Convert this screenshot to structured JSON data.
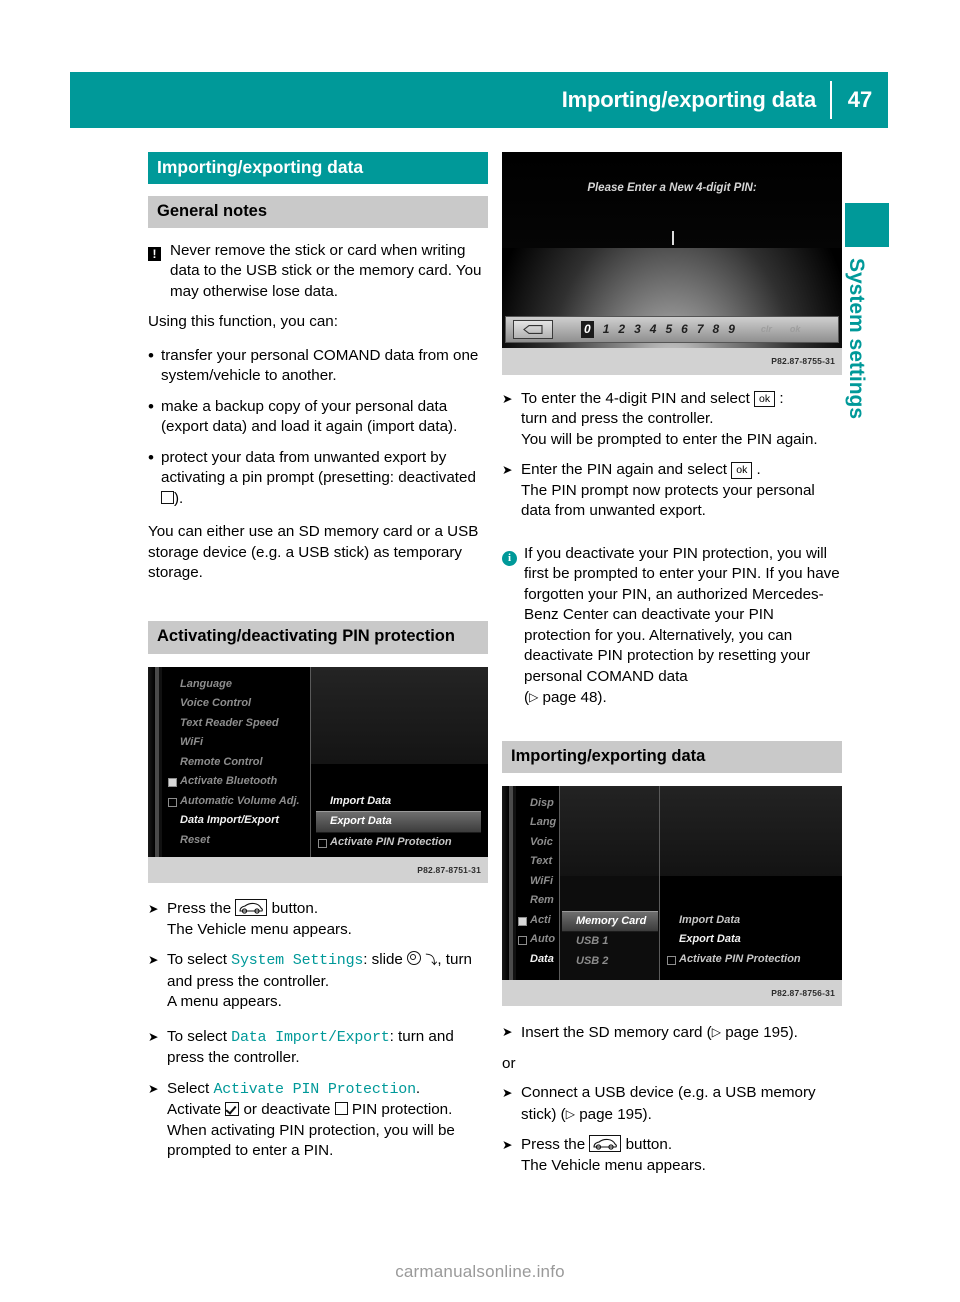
{
  "header": {
    "title": "Importing/exporting data",
    "page_number": "47"
  },
  "side_tab": {
    "label": "System settings",
    "marker": "Z",
    "color": "#009999"
  },
  "left_column": {
    "section_title": "Importing/exporting data",
    "subsection_title": "General notes",
    "warning": "Never remove the stick or card when writing data to the USB stick or the memory card. You may otherwise lose data.",
    "intro": "Using this function, you can:",
    "bullets": [
      "transfer your personal COMAND data from one system/vehicle to another.",
      "make a backup copy of your personal data (export data) and load it again (import data).",
      "protect your data from unwanted export by activating a pin prompt (presetting: deactivated ☐)."
    ],
    "bullet3_pre": "protect your data from unwanted export by activating a pin prompt (presetting: deactivated ",
    "bullet3_post": ").",
    "storage_note": "You can either use an SD memory card or a USB storage device (e.g. a USB stick) as temporary storage.",
    "pin_heading": "Activating/deactivating PIN protection",
    "screenshot": {
      "caption": "P82.87-8751-31",
      "left_menu": [
        {
          "label": "Language",
          "state": "dim",
          "checkbox": "none"
        },
        {
          "label": "Voice Control",
          "state": "dim",
          "checkbox": "none"
        },
        {
          "label": "Text Reader Speed",
          "state": "dim",
          "checkbox": "none"
        },
        {
          "label": "WiFi",
          "state": "dim",
          "checkbox": "none"
        },
        {
          "label": "Remote Control",
          "state": "dim",
          "checkbox": "none"
        },
        {
          "label": "Activate Bluetooth",
          "state": "dim",
          "checkbox": "on"
        },
        {
          "label": "Automatic Volume Adj.",
          "state": "dim",
          "checkbox": "off"
        },
        {
          "label": "Data Import/Export",
          "state": "bright",
          "checkbox": "none"
        },
        {
          "label": "Reset",
          "state": "dim",
          "checkbox": "none"
        }
      ],
      "right_menu": [
        {
          "label": "Import Data",
          "state": "bright",
          "checkbox": "none"
        },
        {
          "label": "Export Data",
          "state": "selected",
          "checkbox": "none"
        },
        {
          "label": "Activate PIN Protection",
          "state": "mid",
          "checkbox": "off"
        }
      ]
    },
    "steps": [
      {
        "marker": "X",
        "text_before_key": "Press the ",
        "key": "vehicle-button",
        "text_after_key": " button.",
        "sub": "The Vehicle menu appears."
      },
      {
        "marker": "X",
        "text_before_cmd": "To select ",
        "command": "System Settings",
        "text_after_cmd": ": slide ",
        "text_tail": ", turn and press the controller.",
        "sub": "A menu appears."
      },
      {
        "marker": "X",
        "text_before_cmd": "To select ",
        "command": "Data Import/Export",
        "text_after_cmd": ": turn and press the controller.",
        "sub": ""
      },
      {
        "marker": "X",
        "text_before_cmd": "Select ",
        "command": "Activate PIN Protection",
        "text_after_cmd": ".",
        "sub_a": "Activate ",
        "sub_b": " or deactivate ",
        "sub_c": " PIN protection. When activating PIN protection, you will be prompted to enter a PIN."
      }
    ]
  },
  "right_column": {
    "pin_screenshot": {
      "prompt": "Please Enter a New 4-digit PIN:",
      "digits": [
        "0",
        "1",
        "2",
        "3",
        "4",
        "5",
        "6",
        "7",
        "8",
        "9"
      ],
      "selected_digit": "0",
      "caption": "P82.87-8755-31",
      "delete_key_icon": "backspace-icon",
      "dim_keys": [
        "clr",
        "ok"
      ]
    },
    "steps": [
      {
        "marker": "X",
        "text_before_key": "To enter the 4-digit PIN and select ",
        "key": "ok",
        "text_after_key": " :",
        "sub1": "turn and press the controller.",
        "sub2": "You will be prompted to enter the PIN again."
      },
      {
        "marker": "X",
        "text_before_key": "Enter the PIN again and select ",
        "key": "ok",
        "text_after_key": " .",
        "sub1": "The PIN prompt now protects your personal data from unwanted export.",
        "sub2": ""
      }
    ],
    "info_note_a": "If you deactivate your PIN protection, you will first be prompted to enter your PIN. If you have forgotten your PIN, an authorized Mercedes-Benz Center can deactivate your PIN protection for you. Alternatively, you can deactivate PIN protection by resetting your personal COMAND data",
    "info_note_ref": "page 48).",
    "import_heading": "Importing/exporting data",
    "import_screenshot": {
      "caption": "P82.87-8756-31",
      "col1": [
        {
          "label": "Disp",
          "state": "dim",
          "checkbox": "none"
        },
        {
          "label": "Lang",
          "state": "dim",
          "checkbox": "none"
        },
        {
          "label": "Voic",
          "state": "dim",
          "checkbox": "none"
        },
        {
          "label": "Text",
          "state": "dim",
          "checkbox": "none"
        },
        {
          "label": "WiFi",
          "state": "dim",
          "checkbox": "none"
        },
        {
          "label": "Rem",
          "state": "dim",
          "checkbox": "none"
        },
        {
          "label": "Acti",
          "state": "dim",
          "checkbox": "on"
        },
        {
          "label": "Auto",
          "state": "dim",
          "checkbox": "off"
        },
        {
          "label": "Data",
          "state": "bright",
          "checkbox": "none"
        }
      ],
      "col2": [
        {
          "label": "Memory Card",
          "state": "selected",
          "checkbox": "none"
        },
        {
          "label": "USB 1",
          "state": "dim",
          "checkbox": "none"
        },
        {
          "label": "USB 2",
          "state": "dim",
          "checkbox": "none"
        }
      ],
      "col3": [
        {
          "label": "Import Data",
          "state": "mid",
          "checkbox": "none"
        },
        {
          "label": "Export Data",
          "state": "bright",
          "checkbox": "none"
        },
        {
          "label": "Activate PIN Protection",
          "state": "mid",
          "checkbox": "off"
        }
      ]
    },
    "final_steps": {
      "step1_pre": "Insert the SD memory card (",
      "step1_post": "page 195).",
      "or": "or",
      "step2_pre": "Connect a USB device (e.g. a USB memory stick) (",
      "step2_post": "page 195).",
      "step3_pre": "Press the ",
      "step3_post": " button.",
      "step3_sub": "The Vehicle menu appears."
    }
  },
  "footer": {
    "watermark": "carmanualsonline.info"
  }
}
